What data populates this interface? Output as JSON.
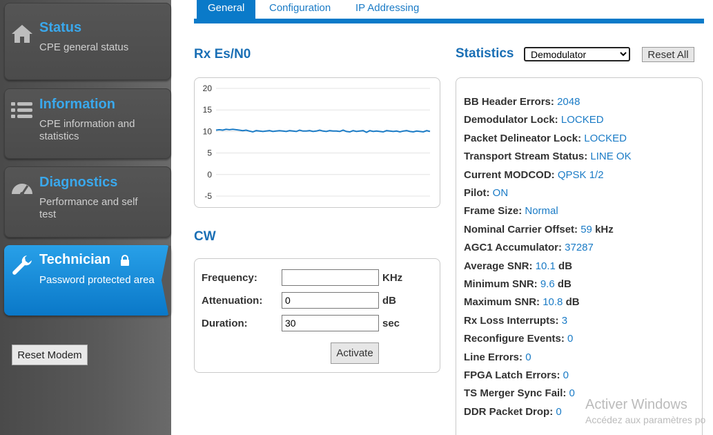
{
  "sidebar": {
    "items": [
      {
        "title": "Status",
        "desc": "CPE general status",
        "icon": "home-icon"
      },
      {
        "title": "Information",
        "desc": "CPE information and statistics",
        "icon": "list-icon"
      },
      {
        "title": "Diagnostics",
        "desc": "Performance and self test",
        "icon": "gauge-icon"
      },
      {
        "title": "Technician",
        "desc": "Password protected area",
        "icon": "wrench-icon",
        "active": true
      }
    ],
    "reset_modem_label": "Reset Modem"
  },
  "tabs": [
    "General",
    "Configuration",
    "IP Addressing"
  ],
  "rx_heading": "Rx Es/N0",
  "chart_data": {
    "type": "line",
    "title": "Rx Es/N0",
    "xlabel": "",
    "ylabel": "",
    "ylim": [
      -5,
      20
    ],
    "yticks": [
      20,
      15,
      10,
      5,
      0,
      -5
    ],
    "grid": true,
    "series": [
      {
        "values": [
          10.3,
          10.4,
          10.3,
          10.5,
          10.4,
          10.5,
          10.4,
          10.3,
          10.2,
          10.3,
          10.1,
          9.9,
          10.2,
          10.1,
          10.0,
          10.1,
          10.2,
          10.0,
          10.1,
          10.2,
          10.1,
          10.0,
          10.2,
          10.1,
          10.0,
          10.3,
          10.1,
          10.1,
          10.2,
          10.0,
          10.1,
          10.3,
          10.1,
          10.0,
          10.2,
          10.1,
          10.1,
          10.0,
          10.3,
          10.0,
          9.9,
          10.2,
          10.0,
          10.1,
          10.2,
          9.8,
          10.2,
          10.0,
          10.1,
          10.0,
          9.9,
          10.2,
          10.1,
          10.0,
          10.1,
          9.9,
          10.1,
          10.2,
          10.0,
          9.9,
          10.1,
          10.0,
          9.9,
          10.2,
          10.0
        ]
      }
    ],
    "color": "#1a7bc6"
  },
  "cw": {
    "heading": "CW",
    "frequency_label": "Frequency:",
    "frequency_value": "",
    "frequency_unit": "KHz",
    "attenuation_label": "Attenuation:",
    "attenuation_value": "0",
    "attenuation_unit": "dB",
    "duration_label": "Duration:",
    "duration_value": "30",
    "duration_unit": "sec",
    "activate_label": "Activate"
  },
  "statistics": {
    "heading": "Statistics",
    "select_value": "Demodulator",
    "reset_all_label": "Reset All",
    "rows": [
      {
        "k": "BB Header Errors:",
        "v": "2048",
        "u": ""
      },
      {
        "k": "Demodulator Lock:",
        "v": "LOCKED",
        "u": ""
      },
      {
        "k": "Packet Delineator Lock:",
        "v": "LOCKED",
        "u": ""
      },
      {
        "k": "Transport Stream Status:",
        "v": "LINE OK",
        "u": ""
      },
      {
        "k": "Current MODCOD:",
        "v": "QPSK 1/2",
        "u": ""
      },
      {
        "k": "Pilot:",
        "v": "ON",
        "u": ""
      },
      {
        "k": "Frame Size:",
        "v": "Normal",
        "u": ""
      },
      {
        "k": "Nominal Carrier Offset:",
        "v": "59",
        "u": "kHz"
      },
      {
        "k": "AGC1 Accumulator:",
        "v": "37287",
        "u": ""
      },
      {
        "k": "Average SNR:",
        "v": "10.1",
        "u": "dB"
      },
      {
        "k": "Minimum SNR:",
        "v": "9.6",
        "u": "dB"
      },
      {
        "k": "Maximum SNR:",
        "v": "10.8",
        "u": "dB"
      },
      {
        "k": "Rx Loss Interrupts:",
        "v": "3",
        "u": ""
      },
      {
        "k": "Reconfigure Events:",
        "v": "0",
        "u": ""
      },
      {
        "k": "Line Errors:",
        "v": "0",
        "u": ""
      },
      {
        "k": "FPGA Latch Errors:",
        "v": "0",
        "u": ""
      },
      {
        "k": "TS Merger Sync Fail:",
        "v": "0",
        "u": ""
      },
      {
        "k": "DDR Packet Drop:",
        "v": "0",
        "u": ""
      }
    ]
  },
  "watermark": {
    "line1": "Activer Windows",
    "line2": "Accédez aux paramètres po"
  }
}
